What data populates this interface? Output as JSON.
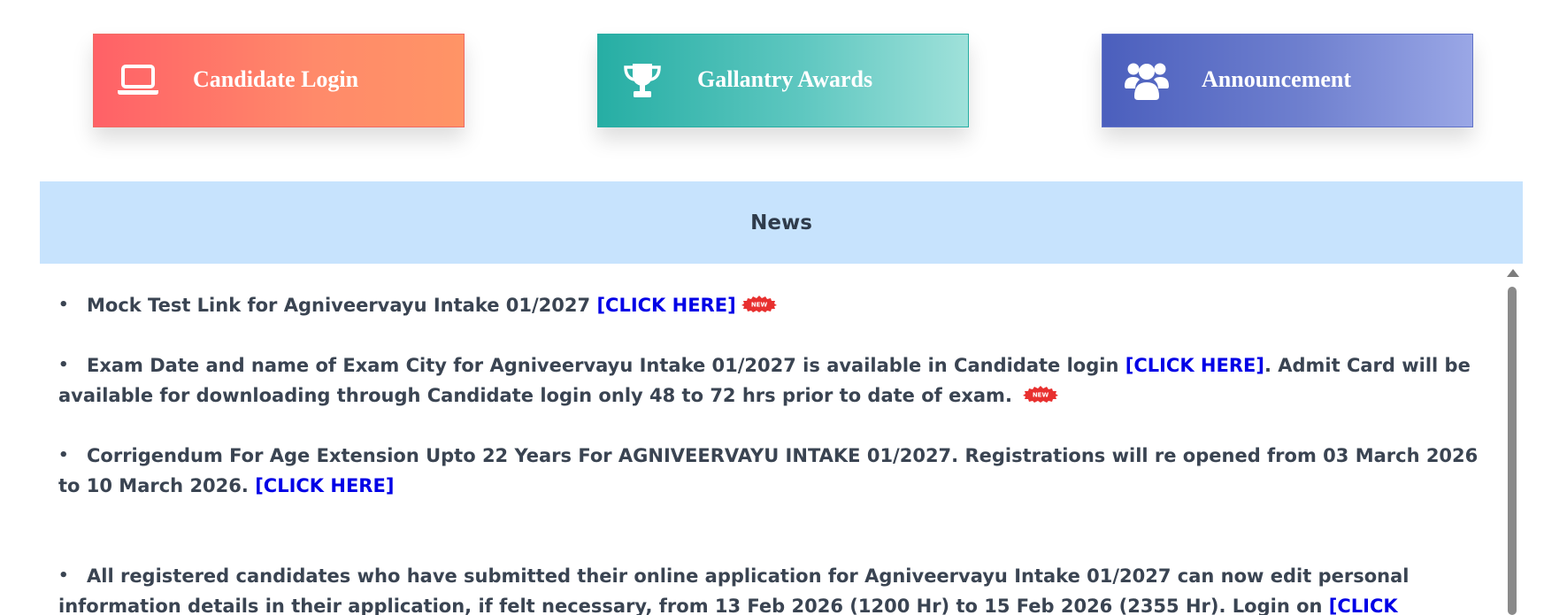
{
  "cards": {
    "candidate_login": {
      "label": "Candidate Login",
      "icon": "laptop-icon"
    },
    "gallantry_awards": {
      "label": "Gallantry Awards",
      "icon": "trophy-icon"
    },
    "announcement": {
      "label": "Announcement",
      "icon": "users-icon"
    }
  },
  "news": {
    "title": "News",
    "new_badge_text": "NEW",
    "items": [
      {
        "text": "Mock Test Link for Agniveervayu Intake 01/2027 ",
        "link": "[CLICK HERE]",
        "badge": true
      },
      {
        "text": "Exam Date and name of Exam City for Agniveervayu Intake 01/2027 is available in Candidate login ",
        "link": "[CLICK HERE]",
        "text_after": ". Admit Card will be available for downloading through Candidate login only 48 to 72 hrs prior to date of exam.",
        "badge": true
      },
      {
        "text": "Corrigendum For Age Extension Upto 22 Years For AGNIVEERVAYU INTAKE 01/2027. Registrations will re opened from 03 March 2026 to 10 March 2026. ",
        "link": "[CLICK HERE]"
      },
      {
        "text": "All registered candidates who have submitted their online application for Agniveervayu Intake 01/2027 can now edit personal information details in their application, if felt necessary, from 13 Feb 2026 (1200 Hr) to 15 Feb 2026 (2355 Hr). Login on ",
        "link": "[CLICK"
      }
    ]
  },
  "colors": {
    "link": "#0000e6",
    "news_header_bg": "#c7e3fd",
    "text": "#3a4452"
  }
}
